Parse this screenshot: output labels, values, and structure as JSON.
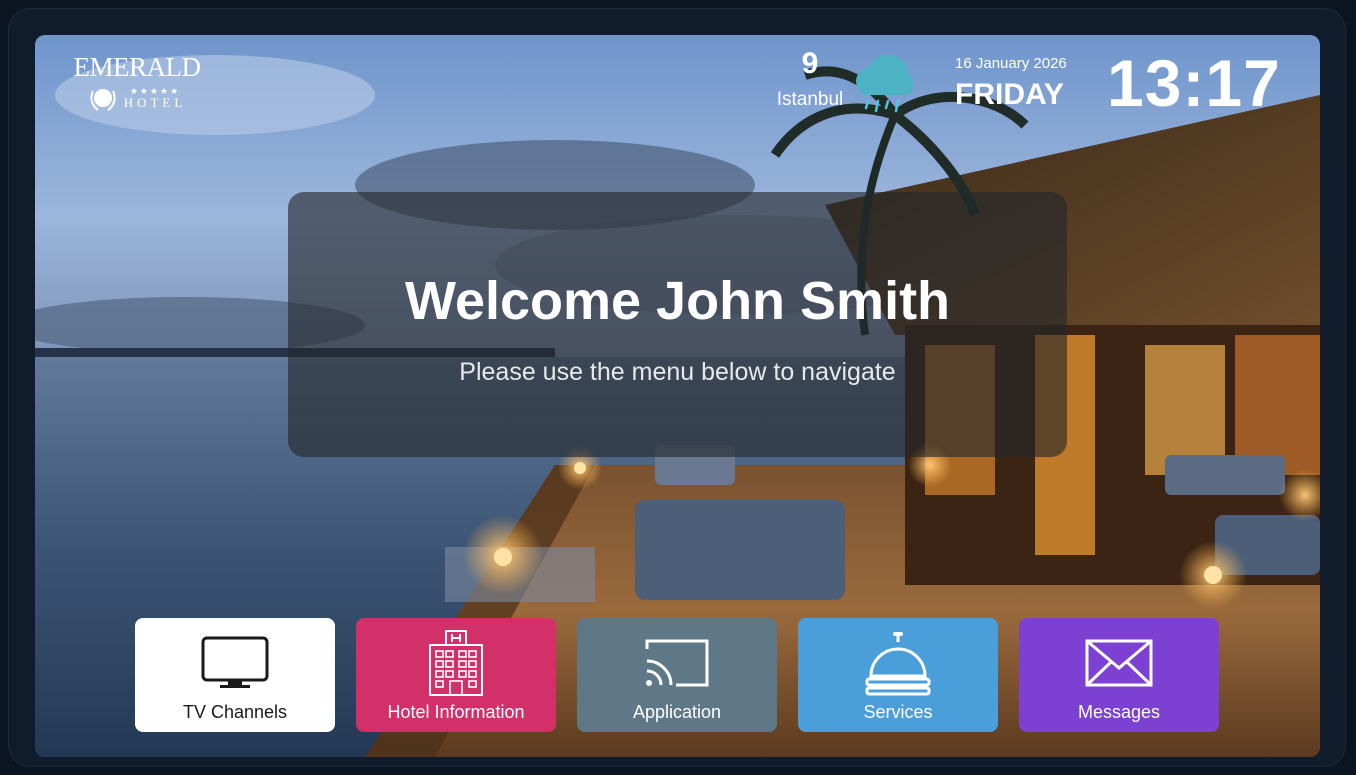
{
  "hotel": {
    "name": "EMERALD",
    "stars": "★★★★★",
    "subtitle": "HOTEL"
  },
  "weather": {
    "temperature": "9",
    "city": "Istanbul",
    "icon": "rain-cloud-icon"
  },
  "datetime": {
    "date": "16 January 2026",
    "day": "FRIDAY",
    "time": "13:17"
  },
  "welcome": {
    "title": "Welcome John Smith",
    "subtitle": "Please use the menu below to navigate"
  },
  "menu": [
    {
      "label": "TV Channels",
      "icon": "tv-icon",
      "color": "#ffffff"
    },
    {
      "label": "Hotel Information",
      "icon": "hotel-building-icon",
      "color": "#d3306a"
    },
    {
      "label": "Application",
      "icon": "cast-icon",
      "color": "#5f7887"
    },
    {
      "label": "Services",
      "icon": "service-bell-icon",
      "color": "#4a9fdb"
    },
    {
      "label": "Messages",
      "icon": "envelope-icon",
      "color": "#7c41d2"
    }
  ]
}
